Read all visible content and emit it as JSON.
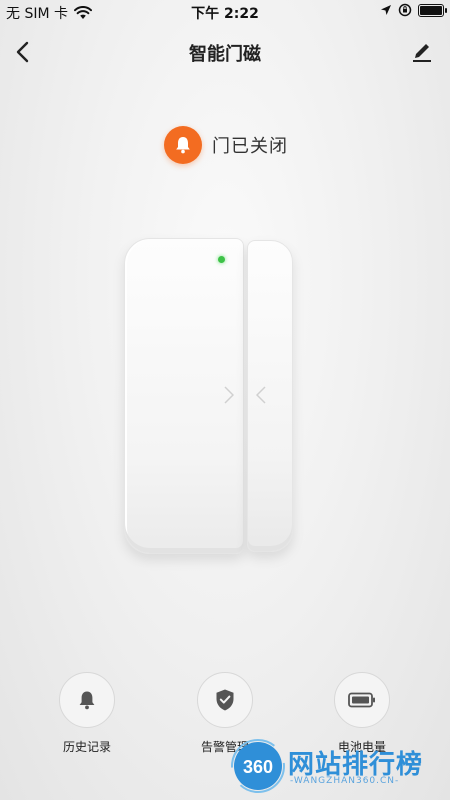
{
  "status_bar": {
    "carrier": "无 SIM 卡",
    "time": "下午 2:22",
    "icons": [
      "wifi-icon",
      "location-arrow-icon",
      "orientation-lock-icon",
      "battery-icon"
    ]
  },
  "nav": {
    "title": "智能门磁",
    "back_icon": "chevron-left-icon",
    "edit_icon": "pencil-icon"
  },
  "sensor_status": {
    "text": "门已关闭",
    "icon": "bell-icon",
    "color": "#f36c21"
  },
  "device": {
    "led_color": "#3dc247"
  },
  "actions": [
    {
      "label": "历史记录",
      "icon": "bell-icon"
    },
    {
      "label": "告警管理",
      "icon": "shield-check-icon"
    },
    {
      "label": "电池电量",
      "icon": "battery-icon"
    }
  ],
  "watermark": {
    "logo": "360",
    "text": "网站排行榜",
    "subtext": "-WANGZHAN360.CN-"
  }
}
